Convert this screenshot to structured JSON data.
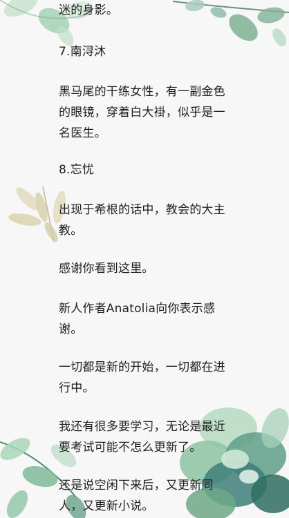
{
  "reader": {
    "lines": [
      "迷的身影。",
      "7.南浔沐",
      "黑马尾的干练女性，有一副金色",
      "的眼镜，穿着白大褂，似乎是一",
      "名医生。",
      "8.忘忧",
      "出现于希根的话中，教会的大主",
      "教。",
      "感谢你看到这里。",
      "新人作者Anatolia向你表示感",
      "谢。",
      "一切都是新的开始，一切都在进",
      "行中。",
      "我还有很多要学习，无论是最近",
      "要考试可能不怎么更新了。",
      "还是说空闲下来后，又更新同",
      "人，又更新小说。"
    ]
  },
  "theme": {
    "background": "#f6f7f6",
    "text_color": "#1f1f1f",
    "leaf_green_light": "#a8d3b0",
    "leaf_green_mid": "#6ea886",
    "leaf_green_dark": "#2f6f60",
    "leaf_beige": "#d7cfae",
    "succulent_teal": "#3f7f7a"
  },
  "decorations": {
    "top_left": "leaf-cluster-icon",
    "top_right": "eucalyptus-branch-icon",
    "mid_left": "dried-leaves-icon",
    "bottom_left": "leaf-cluster-icon",
    "bottom_right": "succulent-icon"
  }
}
